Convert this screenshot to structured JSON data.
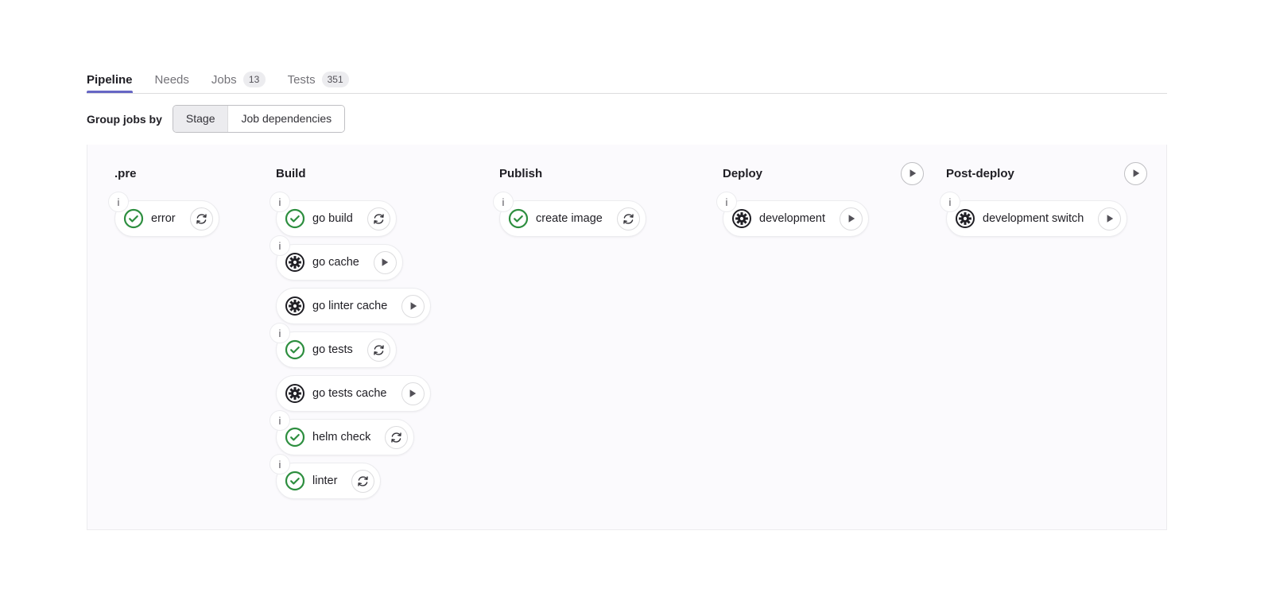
{
  "tabs": [
    {
      "label": "Pipeline",
      "count": null,
      "active": true,
      "name": "tab-pipeline"
    },
    {
      "label": "Needs",
      "count": null,
      "active": false,
      "name": "tab-needs"
    },
    {
      "label": "Jobs",
      "count": "13",
      "active": false,
      "name": "tab-jobs"
    },
    {
      "label": "Tests",
      "count": "351",
      "active": false,
      "name": "tab-tests"
    }
  ],
  "group_by": {
    "label": "Group jobs by",
    "options": [
      {
        "label": "Stage",
        "selected": true
      },
      {
        "label": "Job dependencies",
        "selected": false
      }
    ]
  },
  "colors": {
    "accent": "#6666c4",
    "success": "#2d8e3f",
    "manual": "#1f1e24",
    "panel_bg": "#fbfafd",
    "border": "#ececef",
    "text": "#1f1e24",
    "muted": "#737278"
  },
  "stages": [
    {
      "title": ".pre",
      "has_play": false,
      "play_icon": null,
      "jobs": [
        {
          "name": "error",
          "status": "success",
          "status_icon": "check-circle-icon",
          "action": "retry",
          "action_icon": "retry-icon",
          "has_info": true
        }
      ]
    },
    {
      "title": "Build",
      "has_play": false,
      "play_icon": null,
      "jobs": [
        {
          "name": "go build",
          "status": "success",
          "status_icon": "check-circle-icon",
          "action": "retry",
          "action_icon": "retry-icon",
          "has_info": true
        },
        {
          "name": "go cache",
          "status": "manual",
          "status_icon": "gear-circle-icon",
          "action": "play",
          "action_icon": "play-icon",
          "has_info": true
        },
        {
          "name": "go linter cache",
          "status": "manual",
          "status_icon": "gear-circle-icon",
          "action": "play",
          "action_icon": "play-icon",
          "has_info": false
        },
        {
          "name": "go tests",
          "status": "success",
          "status_icon": "check-circle-icon",
          "action": "retry",
          "action_icon": "retry-icon",
          "has_info": true
        },
        {
          "name": "go tests cache",
          "status": "manual",
          "status_icon": "gear-circle-icon",
          "action": "play",
          "action_icon": "play-icon",
          "has_info": false
        },
        {
          "name": "helm check",
          "status": "success",
          "status_icon": "check-circle-icon",
          "action": "retry",
          "action_icon": "retry-icon",
          "has_info": true
        },
        {
          "name": "linter",
          "status": "success",
          "status_icon": "check-circle-icon",
          "action": "retry",
          "action_icon": "retry-icon",
          "has_info": true
        }
      ]
    },
    {
      "title": "Publish",
      "has_play": false,
      "play_icon": null,
      "jobs": [
        {
          "name": "create image",
          "status": "success",
          "status_icon": "check-circle-icon",
          "action": "retry",
          "action_icon": "retry-icon",
          "has_info": true
        }
      ]
    },
    {
      "title": "Deploy",
      "has_play": true,
      "play_icon": "play-icon",
      "jobs": [
        {
          "name": "development",
          "status": "manual",
          "status_icon": "gear-circle-icon",
          "action": "play",
          "action_icon": "play-icon",
          "has_info": true
        }
      ]
    },
    {
      "title": "Post-deploy",
      "has_play": true,
      "play_icon": "play-icon",
      "jobs": [
        {
          "name": "development switch",
          "status": "manual",
          "status_icon": "gear-circle-icon",
          "action": "play",
          "action_icon": "play-icon",
          "has_info": true
        }
      ]
    }
  ],
  "info_badge_label": "i"
}
